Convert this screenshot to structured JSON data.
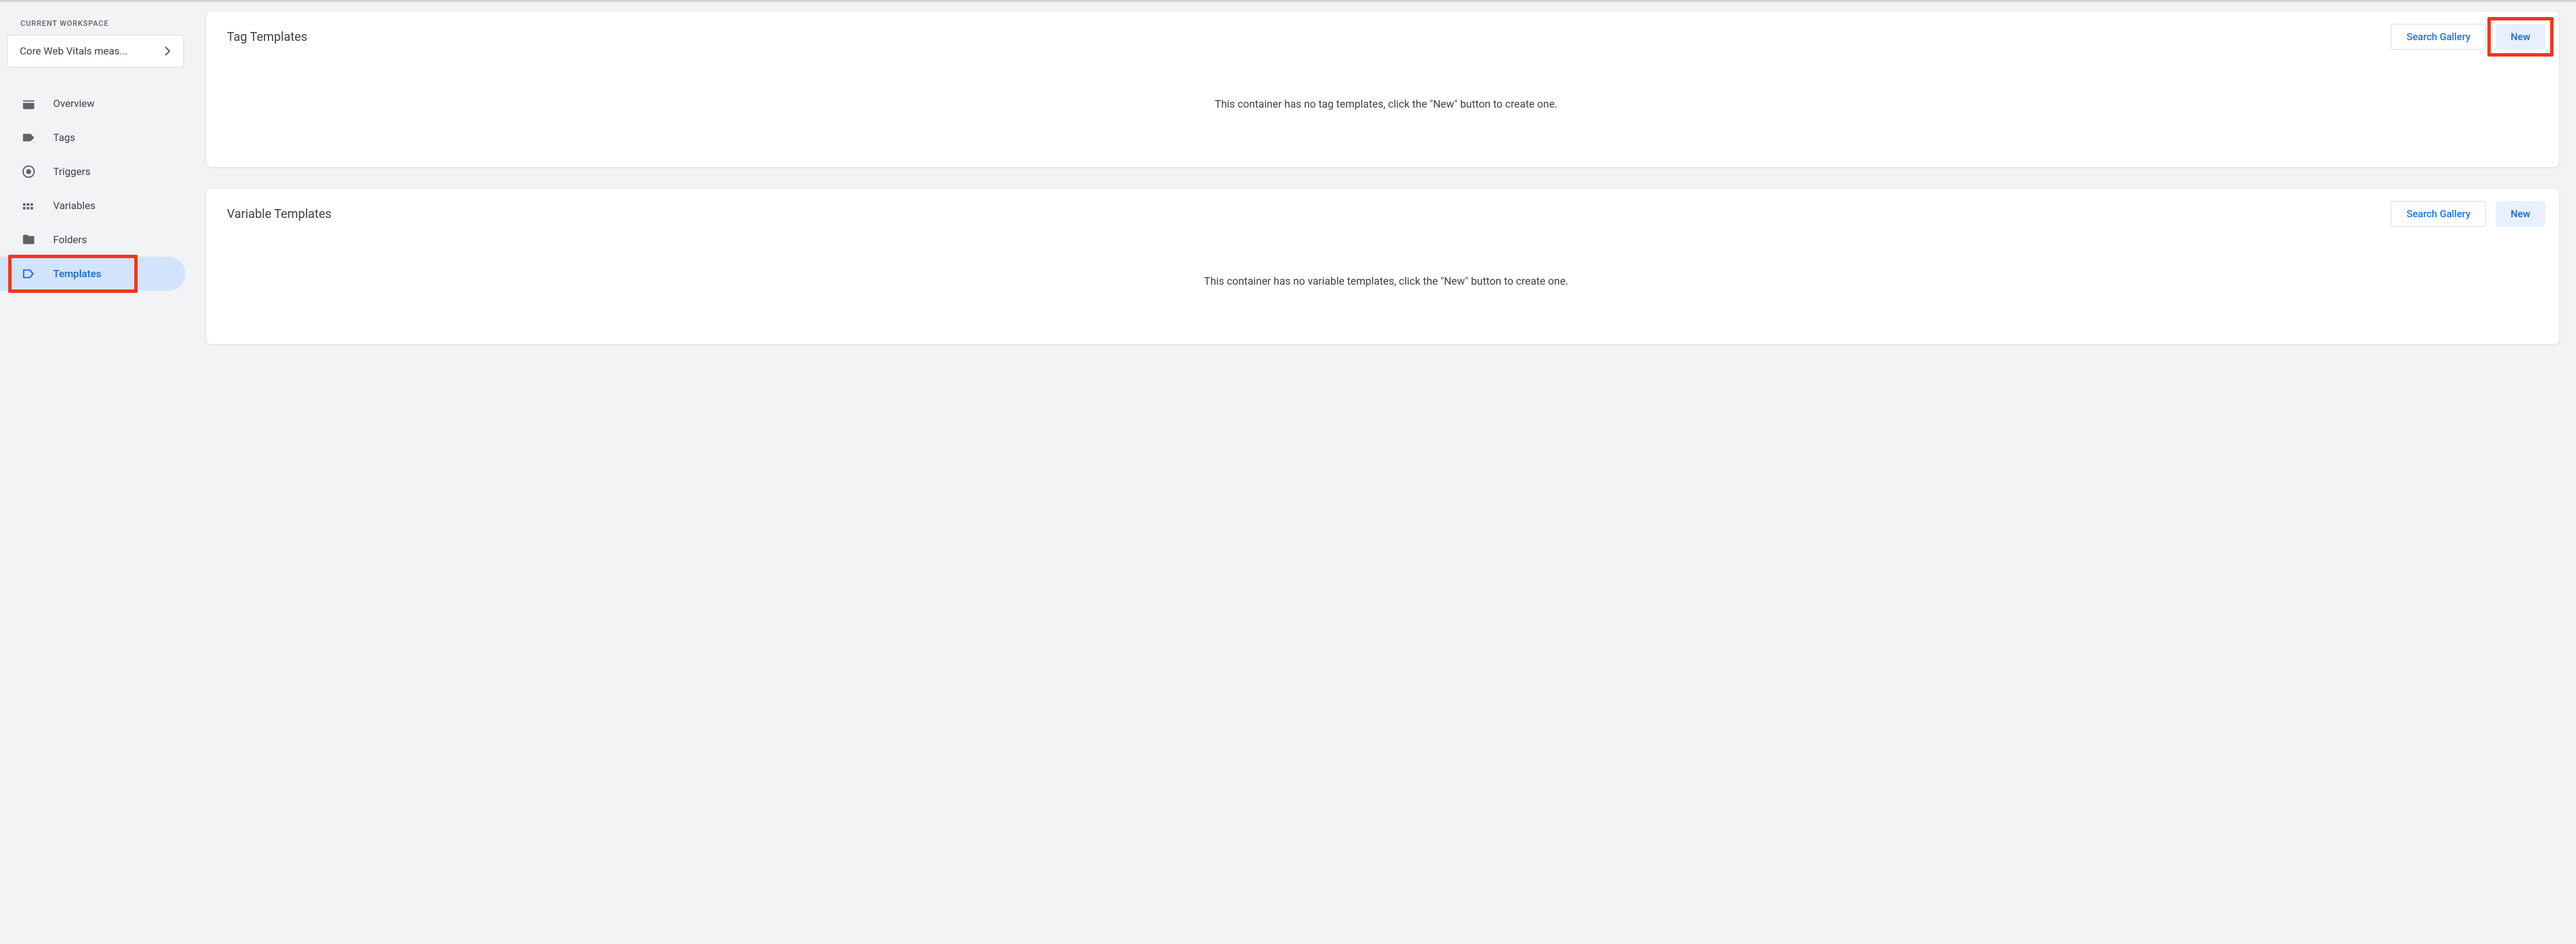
{
  "sidebar": {
    "workspace_label": "CURRENT WORKSPACE",
    "workspace_name": "Core Web Vitals meas...",
    "items": [
      {
        "label": "Overview"
      },
      {
        "label": "Tags"
      },
      {
        "label": "Triggers"
      },
      {
        "label": "Variables"
      },
      {
        "label": "Folders"
      },
      {
        "label": "Templates"
      }
    ]
  },
  "cards": {
    "tag_templates": {
      "title": "Tag Templates",
      "search_label": "Search Gallery",
      "new_label": "New",
      "empty_message": "This container has no tag templates, click the \"New\" button to create one."
    },
    "variable_templates": {
      "title": "Variable Templates",
      "search_label": "Search Gallery",
      "new_label": "New",
      "empty_message": "This container has no variable templates, click the \"New\" button to create one."
    }
  }
}
